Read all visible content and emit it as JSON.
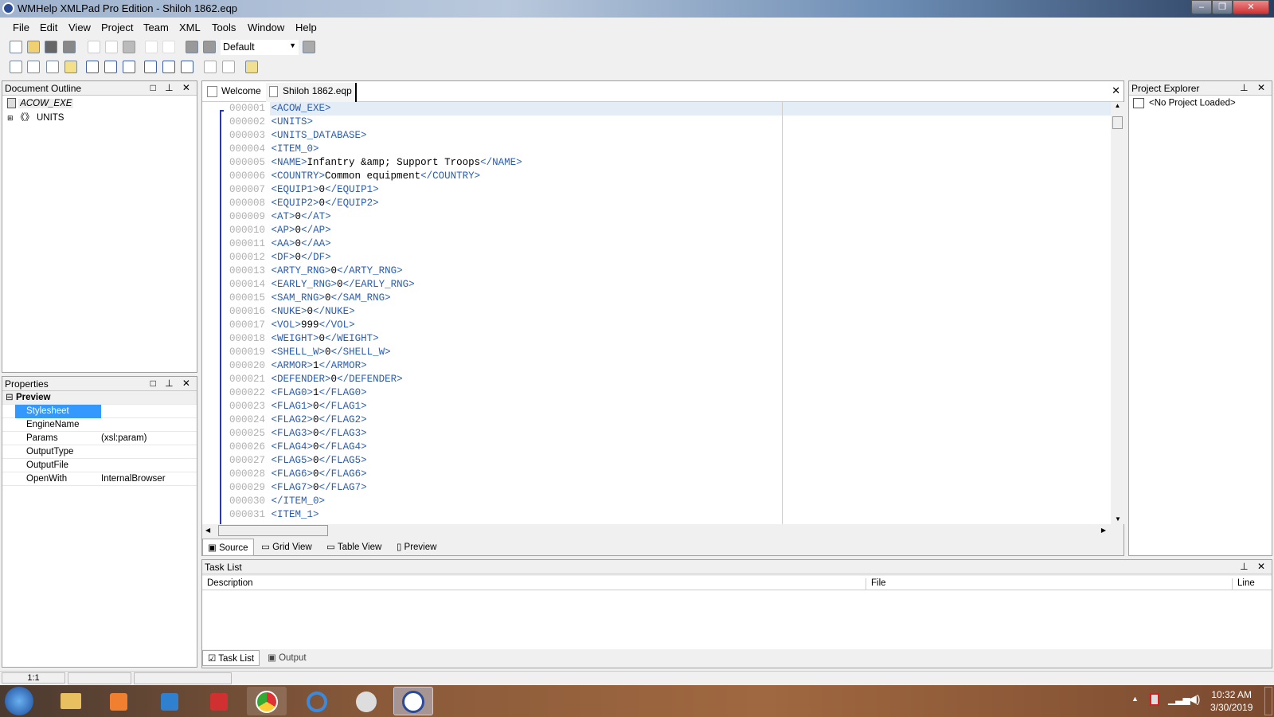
{
  "window": {
    "title": "WMHelp XMLPad Pro Edition - Shiloh 1862.eqp"
  },
  "menu": [
    "File",
    "Edit",
    "View",
    "Project",
    "Team",
    "XML",
    "Tools",
    "Window",
    "Help"
  ],
  "toolbar": {
    "profile_select": "Default"
  },
  "outline": {
    "title": "Document Outline",
    "root": "ACOW_EXE",
    "child": "UNITS"
  },
  "properties": {
    "title": "Properties",
    "group": "Preview",
    "rows": [
      {
        "k": "Stylesheet",
        "v": ""
      },
      {
        "k": "EngineName",
        "v": ""
      },
      {
        "k": "Params",
        "v": "(xsl:param)"
      },
      {
        "k": "OutputType",
        "v": ""
      },
      {
        "k": "OutputFile",
        "v": ""
      },
      {
        "k": "OpenWith",
        "v": "InternalBrowser"
      }
    ]
  },
  "editor": {
    "tabs": [
      "Welcome",
      "Shiloh 1862.eqp"
    ],
    "lines": [
      [
        "000001",
        "<ACOW_EXE>",
        "",
        ""
      ],
      [
        "000002",
        "<UNITS>",
        "",
        ""
      ],
      [
        "000003",
        "<UNITS_DATABASE>",
        "",
        ""
      ],
      [
        "000004",
        "<ITEM_0>",
        "",
        ""
      ],
      [
        "000005",
        "<NAME>",
        "Infantry &amp; Support Troops",
        "</NAME>"
      ],
      [
        "000006",
        "<COUNTRY>",
        "Common equipment",
        "</COUNTRY>"
      ],
      [
        "000007",
        "<EQUIP1>",
        "0",
        "</EQUIP1>"
      ],
      [
        "000008",
        "<EQUIP2>",
        "0",
        "</EQUIP2>"
      ],
      [
        "000009",
        "<AT>",
        "0",
        "</AT>"
      ],
      [
        "000010",
        "<AP>",
        "0",
        "</AP>"
      ],
      [
        "000011",
        "<AA>",
        "0",
        "</AA>"
      ],
      [
        "000012",
        "<DF>",
        "0",
        "</DF>"
      ],
      [
        "000013",
        "<ARTY_RNG>",
        "0",
        "</ARTY_RNG>"
      ],
      [
        "000014",
        "<EARLY_RNG>",
        "0",
        "</EARLY_RNG>"
      ],
      [
        "000015",
        "<SAM_RNG>",
        "0",
        "</SAM_RNG>"
      ],
      [
        "000016",
        "<NUKE>",
        "0",
        "</NUKE>"
      ],
      [
        "000017",
        "<VOL>",
        "999",
        "</VOL>"
      ],
      [
        "000018",
        "<WEIGHT>",
        "0",
        "</WEIGHT>"
      ],
      [
        "000019",
        "<SHELL_W>",
        "0",
        "</SHELL_W>"
      ],
      [
        "000020",
        "<ARMOR>",
        "1",
        "</ARMOR>"
      ],
      [
        "000021",
        "<DEFENDER>",
        "0",
        "</DEFENDER>"
      ],
      [
        "000022",
        "<FLAG0>",
        "1",
        "</FLAG0>"
      ],
      [
        "000023",
        "<FLAG1>",
        "0",
        "</FLAG1>"
      ],
      [
        "000024",
        "<FLAG2>",
        "0",
        "</FLAG2>"
      ],
      [
        "000025",
        "<FLAG3>",
        "0",
        "</FLAG3>"
      ],
      [
        "000026",
        "<FLAG4>",
        "0",
        "</FLAG4>"
      ],
      [
        "000027",
        "<FLAG5>",
        "0",
        "</FLAG5>"
      ],
      [
        "000028",
        "<FLAG6>",
        "0",
        "</FLAG6>"
      ],
      [
        "000029",
        "<FLAG7>",
        "0",
        "</FLAG7>"
      ],
      [
        "000030",
        "</ITEM_0>",
        "",
        ""
      ],
      [
        "000031",
        "<ITEM_1>",
        "",
        ""
      ]
    ],
    "view_tabs": [
      "Source",
      "Grid View",
      "Table View",
      "Preview"
    ]
  },
  "project": {
    "title": "Project Explorer",
    "empty": "<No Project Loaded>"
  },
  "tasklist": {
    "title": "Task List",
    "columns": [
      "Description",
      "File",
      "Line"
    ],
    "tabs": [
      "Task List",
      "Output"
    ]
  },
  "status": {
    "position": "1:1"
  },
  "clock": {
    "time": "10:32 AM",
    "date": "3/30/2019"
  }
}
